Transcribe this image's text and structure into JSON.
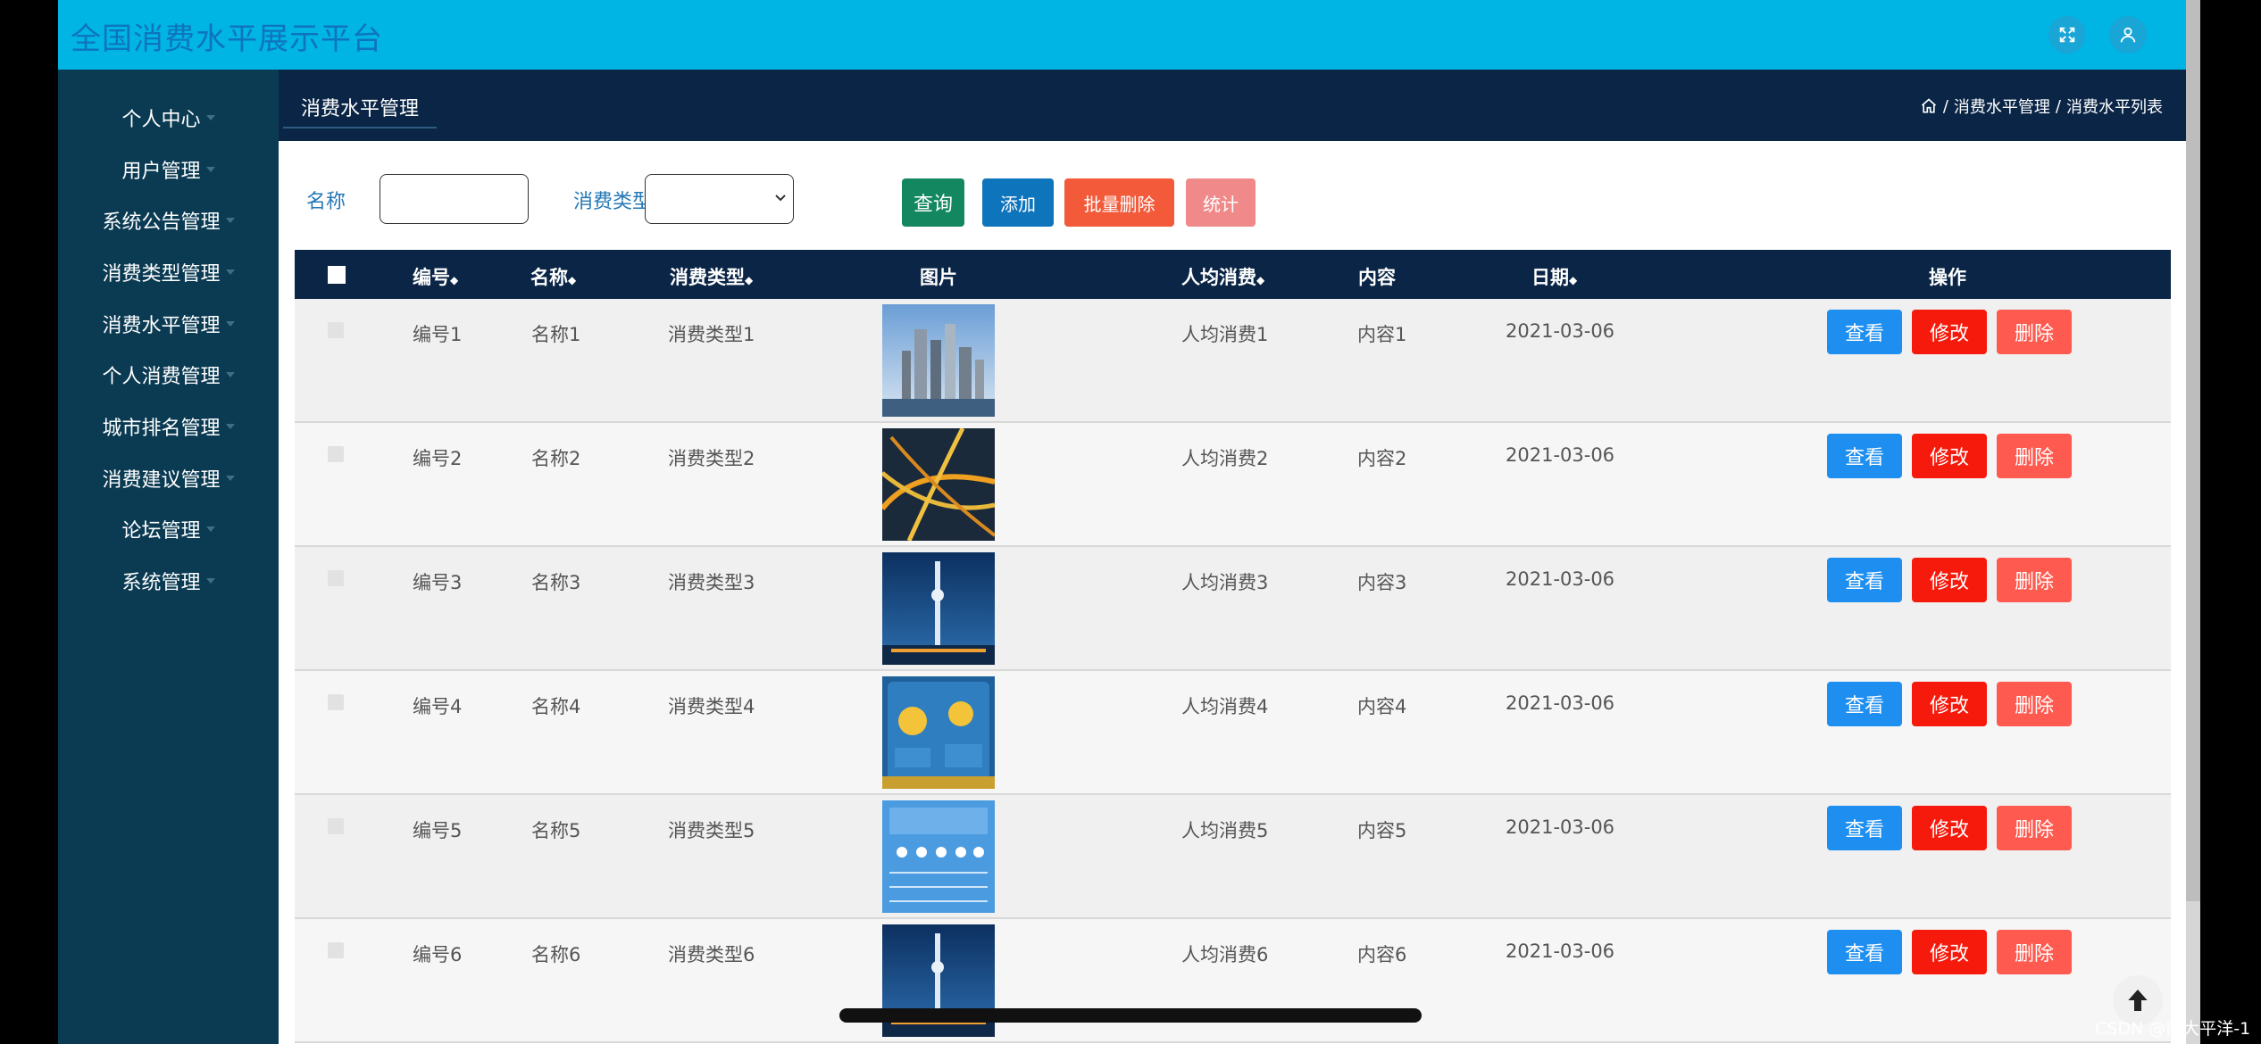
{
  "app": {
    "title": "全国消费水平展示平台"
  },
  "sidebar": {
    "items": [
      {
        "label": "个人中心"
      },
      {
        "label": "用户管理"
      },
      {
        "label": "系统公告管理"
      },
      {
        "label": "消费类型管理"
      },
      {
        "label": "消费水平管理"
      },
      {
        "label": "个人消费管理"
      },
      {
        "label": "城市排名管理"
      },
      {
        "label": "消费建议管理"
      },
      {
        "label": "论坛管理"
      },
      {
        "label": "系统管理"
      }
    ]
  },
  "header": {
    "section_title": "消费水平管理",
    "breadcrumb": [
      "/",
      "消费水平管理",
      "/",
      "消费水平列表"
    ]
  },
  "filter": {
    "name_label": "名称",
    "name_value": "",
    "type_label": "消费类型",
    "type_selected": "",
    "query_label": "查询",
    "add_label": "添加",
    "batch_delete_label": "批量删除",
    "stats_label": "统计"
  },
  "table": {
    "headers": [
      "编号",
      "名称",
      "消费类型",
      "图片",
      "人均消费",
      "内容",
      "日期",
      "操作"
    ],
    "sort_glyph": "◆",
    "rows": [
      {
        "id": "编号1",
        "name": "名称1",
        "type": "消费类型1",
        "image": "city-skyline",
        "avg": "人均消费1",
        "content": "内容1",
        "date": "2021-03-06"
      },
      {
        "id": "编号2",
        "name": "名称2",
        "type": "消费类型2",
        "image": "highway-interchange-night",
        "avg": "人均消费2",
        "content": "内容2",
        "date": "2021-03-06"
      },
      {
        "id": "编号3",
        "name": "名称3",
        "type": "消费类型3",
        "image": "tv-tower-blue",
        "avg": "人均消费3",
        "content": "内容3",
        "date": "2021-03-06"
      },
      {
        "id": "编号4",
        "name": "名称4",
        "type": "消费类型4",
        "image": "weather-app-screen",
        "avg": "人均消费4",
        "content": "内容4",
        "date": "2021-03-06"
      },
      {
        "id": "编号5",
        "name": "名称5",
        "type": "消费类型5",
        "image": "weather-forecast-screen",
        "avg": "人均消费5",
        "content": "内容5",
        "date": "2021-03-06"
      },
      {
        "id": "编号6",
        "name": "名称6",
        "type": "消费类型6",
        "image": "tv-tower-blue",
        "avg": "人均消费6",
        "content": "内容6",
        "date": "2021-03-06"
      }
    ],
    "actions": {
      "view": "查看",
      "edit": "修改",
      "delete": "删除"
    }
  },
  "watermark": "CSDN @南大平洋-1",
  "colors": {
    "topbar": "#00b4e4",
    "sidebar": "#0b3b53",
    "header": "#0a2546",
    "query": "#13875f",
    "add": "#0e74bc",
    "batch_delete": "#f25a3a",
    "stats": "#f08a8a",
    "view": "#1e8ff0",
    "edit": "#f51a0c",
    "delete": "#ff5a4f"
  },
  "icons": {
    "fullscreen": "fullscreen-icon",
    "user": "user-icon",
    "home": "home-icon",
    "back_to_top": "arrow-up-icon"
  }
}
